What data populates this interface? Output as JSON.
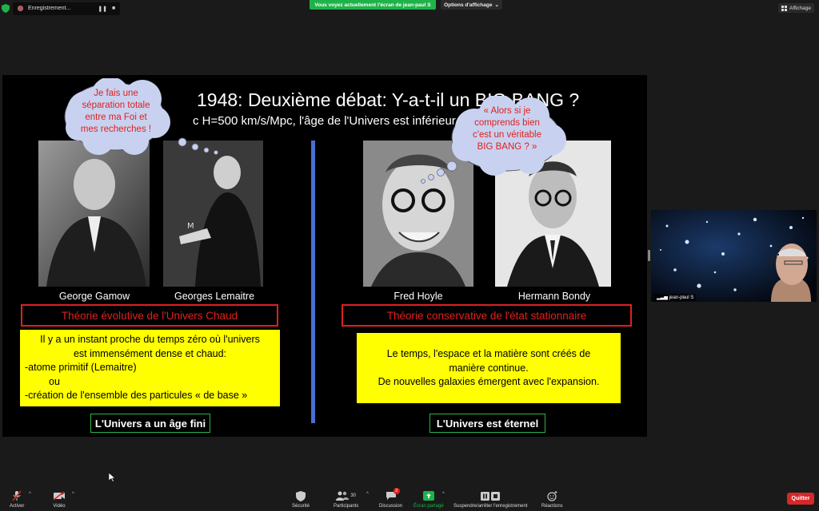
{
  "topbar": {
    "recording_label": "Enregistrement...",
    "share_banner": "Vous voyez actuellement l'écran de jean-paul S",
    "view_options": "Options d'affichage",
    "affichage": "Affichage"
  },
  "slide": {
    "title": "1948: Deuxième débat: Y-a-t-il un BIG BANG ?",
    "subtitle": "c H=500 km/s/Mpc, l'âge de l'Univers est inférieur",
    "left": {
      "cloud": "Je fais une séparation totale entre ma Foi et mes recherches !",
      "captions": [
        "George Gamow",
        "Georges Lemaitre"
      ],
      "theory": "Théorie  évolutive de l'Univers Chaud",
      "description": [
        "Il y a un instant proche du temps zéro où l'univers",
        "est immensément dense et chaud:",
        "-atome primitif  (Lemaitre)",
        "ou",
        "-création de l'ensemble des particules « de base »"
      ],
      "conclusion": "L'Univers a un âge fini"
    },
    "right": {
      "cloud": "« Alors si je comprends bien c'est un  véritable BIG BANG ? »",
      "captions": [
        "Fred Hoyle",
        "Hermann Bondy"
      ],
      "theory": "Théorie conservative de l'état stationnaire",
      "description": [
        "Le temps, l'espace et la matière sont créés de",
        "manière continue.",
        "De nouvelles galaxies émergent avec l'expansion."
      ],
      "conclusion": "L'Univers est éternel"
    }
  },
  "video": {
    "participant_name": "jean-paul S"
  },
  "toolbar": {
    "items": [
      {
        "label": "Activer",
        "icon": "microphone-muted-icon"
      },
      {
        "label": "Vidéo",
        "icon": "video-camera-icon"
      },
      {
        "label": "Sécurité",
        "icon": "shield-icon"
      },
      {
        "label": "Participants",
        "icon": "participants-icon",
        "count": "30"
      },
      {
        "label": "Discussion",
        "icon": "chat-icon",
        "badge": "3"
      },
      {
        "label": "Écran partagé",
        "icon": "share-screen-icon"
      },
      {
        "label": "Suspendre/arrêter l'enregistrement",
        "icon": "pause-stop-icon"
      },
      {
        "label": "Réactions",
        "icon": "reactions-icon"
      }
    ],
    "quit": "Quitter"
  },
  "colors": {
    "share_green": "#1fb24a",
    "slide_red": "#e02020",
    "slide_yellow": "#ffff00",
    "divider_blue": "#4a6fd1",
    "quit_red": "#d62828"
  }
}
